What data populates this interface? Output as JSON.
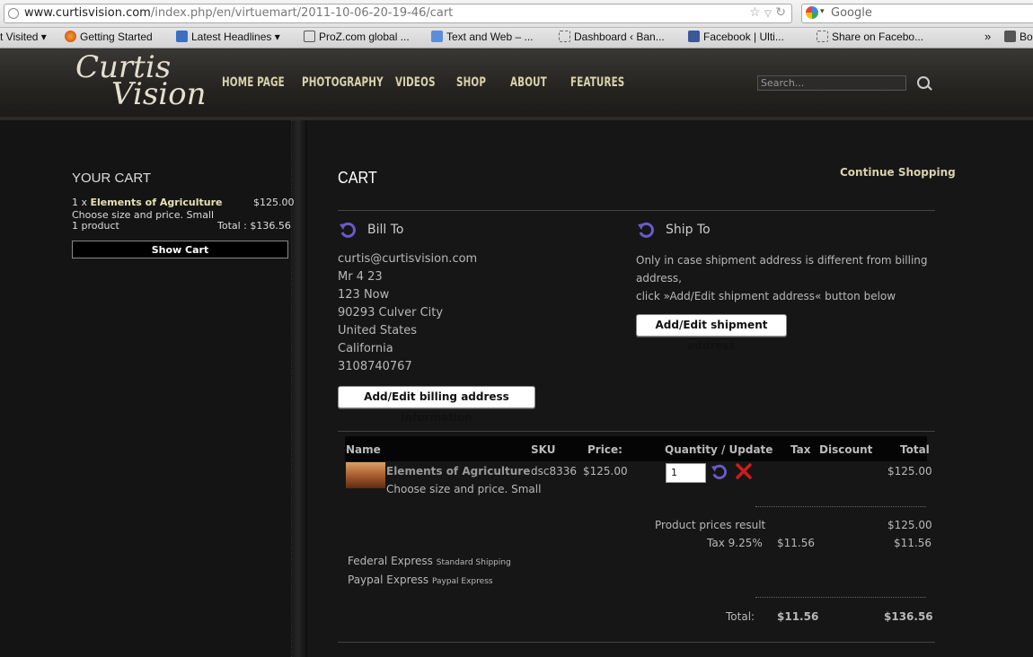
{
  "browser": {
    "url_host": "www.curtisvision.com",
    "url_path": "/index.php/en/virtuemart/2011-10-06-20-19-46/cart",
    "search_engine": "Google",
    "bookmarks": [
      "t Visited",
      "Getting Started",
      "Latest Headlines",
      "ProZ.com global ...",
      "Text and Web – ...",
      "Dashboard ‹ Ban...",
      "Facebook | Ulti...",
      "Share on Facebo...",
      "Bo"
    ]
  },
  "site": {
    "logo_line1": "Curtis",
    "logo_line2": "Vision",
    "nav": [
      "HOME PAGE",
      "PHOTOGRAPHY",
      "VIDEOS",
      "SHOP",
      "ABOUT",
      "FEATURES"
    ],
    "search_placeholder": "Search..."
  },
  "sidebar": {
    "title": "YOUR CART",
    "qty_prefix": "1 x",
    "item_name": "Elements of Agriculture",
    "item_price": "$125.00",
    "item_variant": "Choose size and price. Small",
    "product_count": "1 product",
    "total": "Total : $136.56",
    "show_cart": "Show Cart"
  },
  "cart": {
    "title": "CART",
    "continue_shopping": "Continue Shopping",
    "bill_to": "Bill To",
    "ship_to": "Ship To",
    "billing_address": [
      "curtis@curtisvision.com",
      "Mr 4 23",
      "123 Now",
      "90293 Culver City",
      "United States",
      "California",
      "3108740767"
    ],
    "billing_button": "Add/Edit billing address information",
    "ship_note": [
      "Only in case shipment address is different from billing",
      "address,",
      "click »Add/Edit shipment address« button below"
    ],
    "shipment_button": "Add/Edit shipment address",
    "columns": [
      "Name",
      "SKU",
      "Price:",
      "Quantity / Update",
      "Tax",
      "Discount",
      "Total"
    ],
    "item": {
      "name": "Elements of Agriculture",
      "variant": "Choose size and price. Small",
      "sku": "dsc8336",
      "price": "$125.00",
      "qty": "1",
      "total": "$125.00"
    },
    "product_prices_label": "Product prices result",
    "product_prices_total": "$125.00",
    "tax_label": "Tax 9.25%",
    "tax_amount": "$11.56",
    "tax_total": "$11.56",
    "shipping": [
      {
        "name": "Federal Express",
        "desc": "Standard Shipping"
      },
      {
        "name": "Paypal Express",
        "desc": "Paypal Express"
      }
    ],
    "total_label": "Total:",
    "total_tax": "$11.56",
    "grand_total": "$136.56"
  },
  "colors": {
    "accent_nav": "#d9d2ac",
    "icon_purple": "#6a5acd",
    "delete_red": "#d21a1a"
  }
}
